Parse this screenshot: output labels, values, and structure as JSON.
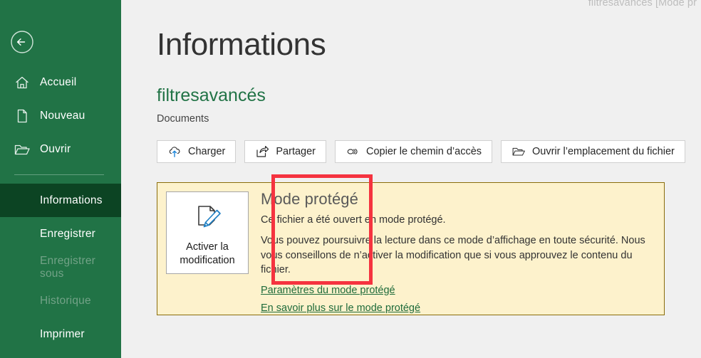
{
  "window": {
    "title_text": "filtresavancés  [Mode pr"
  },
  "colors": {
    "sidebar_green": "#217346",
    "sidebar_active_green": "#0c4423",
    "accent_green": "#217346",
    "panel_bg": "#fdf2cc",
    "panel_border": "#8a6d0b",
    "highlight_red": "#f5333f",
    "page_bg": "#f0f0f0"
  },
  "sidebar": {
    "back_label": "Retour",
    "back_icon": "back-arrow-circle-icon",
    "items": [
      {
        "label": "Accueil",
        "icon": "home-icon",
        "state": "normal"
      },
      {
        "label": "Nouveau",
        "icon": "new-document-icon",
        "state": "normal"
      },
      {
        "label": "Ouvrir",
        "icon": "open-folder-icon",
        "state": "normal"
      }
    ],
    "items_lower": [
      {
        "label": "Informations",
        "state": "active"
      },
      {
        "label": "Enregistrer",
        "state": "normal"
      },
      {
        "label": "Enregistrer sous",
        "state": "disabled"
      },
      {
        "label": "Historique",
        "state": "disabled"
      },
      {
        "label": "Imprimer",
        "state": "normal"
      }
    ]
  },
  "main": {
    "page_title": "Informations",
    "document_name": "filtresavancés",
    "document_location": "Documents",
    "actions": [
      {
        "label": "Charger",
        "icon": "cloud-upload-icon"
      },
      {
        "label": "Partager",
        "icon": "share-icon"
      },
      {
        "label": "Copier le chemin d’accès",
        "icon": "link-copy-icon"
      },
      {
        "label": "Ouvrir l’emplacement du fichier",
        "icon": "folder-open-icon"
      }
    ],
    "protected_panel": {
      "enable_button_label_line1": "Activer la",
      "enable_button_label_line2": "modification",
      "enable_button_icon": "document-edit-pencil-icon",
      "heading": "Mode protégé",
      "paragraph1": "Ce fichier a été ouvert en mode protégé.",
      "paragraph2": "Vous pouvez poursuivre la lecture dans ce mode d’affichage en toute sécurité. Nous vous conseillons de n’activer la modification que si vous approuvez le contenu du fichier.",
      "link1": "Paramètres du mode protégé",
      "link2": "En savoir plus sur le mode protégé"
    }
  }
}
